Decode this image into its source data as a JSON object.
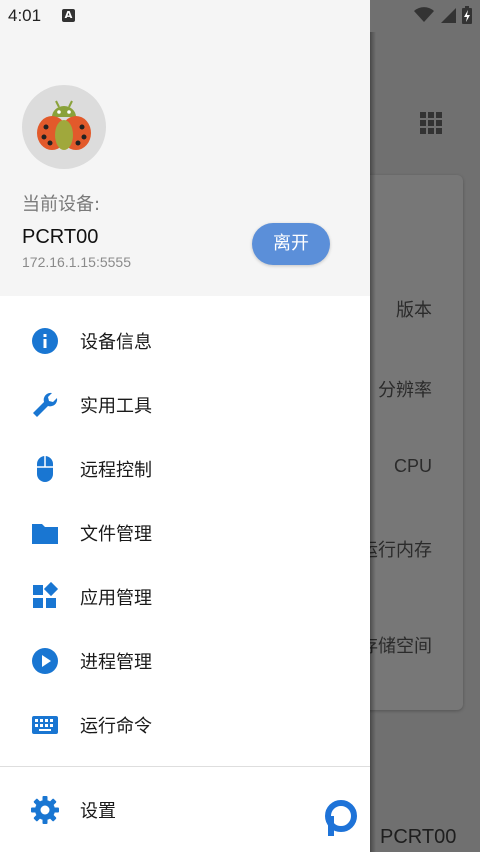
{
  "status_bar": {
    "time": "4:01",
    "notification_letter": "A"
  },
  "drawer": {
    "current_device_label": "当前设备:",
    "device_name": "PCRT00",
    "device_address": "172.16.1.15:5555",
    "leave_button_label": "离开",
    "menu_items": [
      {
        "label": "设备信息",
        "icon": "info-icon"
      },
      {
        "label": "实用工具",
        "icon": "wrench-icon"
      },
      {
        "label": "远程控制",
        "icon": "mouse-icon"
      },
      {
        "label": "文件管理",
        "icon": "folder-icon"
      },
      {
        "label": "应用管理",
        "icon": "apps-icon"
      },
      {
        "label": "进程管理",
        "icon": "play-circle-icon"
      },
      {
        "label": "运行命令",
        "icon": "keyboard-icon"
      }
    ],
    "settings_label": "设置"
  },
  "background": {
    "labels": [
      "版本",
      "分辨率",
      "CPU",
      "运行内存",
      "存储空间"
    ],
    "footer_text": "PCRT00"
  },
  "colors": {
    "accent": "#1976d2",
    "button": "#5b8fd9",
    "scrim": "#707070"
  }
}
